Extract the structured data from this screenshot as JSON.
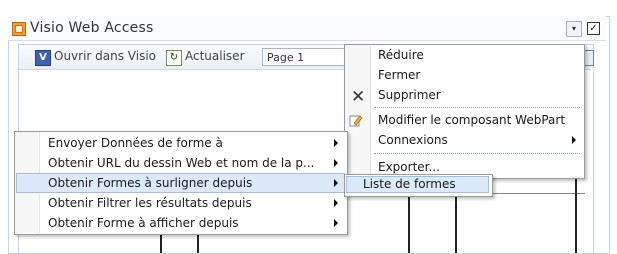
{
  "webpart": {
    "title": "Visio Web Access",
    "dropdown_glyph": "▾",
    "checkbox_glyph": "✓"
  },
  "toolbar": {
    "open_label": "Ouvrir dans Visio",
    "refresh_label": "Actualiser",
    "page_select_value": "Page 1",
    "open_icon_glyph": "V",
    "refresh_icon_glyph": "↻"
  },
  "webpart_menu": {
    "items": [
      {
        "label": "Réduire"
      },
      {
        "label": "Fermer"
      },
      {
        "label": "Supprimer",
        "icon": "close-x-icon"
      },
      {
        "label": "Modifier le composant WebPart",
        "icon": "edit-pencil-icon"
      },
      {
        "label": "Connexions",
        "has_submenu": true
      },
      {
        "label": "Exporter..."
      }
    ],
    "delete_icon_glyph": "✕"
  },
  "connections_submenu": {
    "items": [
      {
        "label": "Envoyer Données de forme à"
      },
      {
        "label": "Obtenir URL du dessin Web et nom de la p..."
      },
      {
        "label": "Obtenir Formes à surligner depuis",
        "highlighted": true
      },
      {
        "label": "Obtenir Filtrer les résultats depuis"
      },
      {
        "label": "Obtenir Forme à afficher depuis"
      }
    ]
  },
  "shapes_submenu": {
    "items": [
      {
        "label": "Liste de formes",
        "highlighted": true
      }
    ]
  },
  "colors": {
    "highlight_bg": "#dbe9f8",
    "highlight_border": "#9fbfe3",
    "visio_brand": "#3a62b0"
  }
}
